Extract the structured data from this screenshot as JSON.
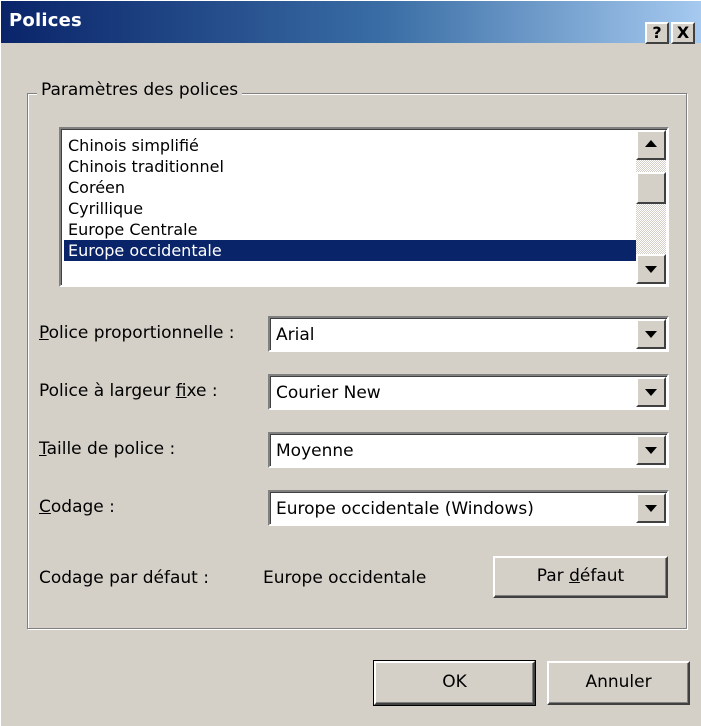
{
  "window": {
    "title": "Polices",
    "help_button": "?",
    "close_button": "X"
  },
  "group": {
    "legend": "Paramètres des polices"
  },
  "script_list": {
    "items": [
      "Chinois simplifié",
      "Chinois traditionnel",
      "Coréen",
      "Cyrillique",
      "Europe Centrale",
      "Europe occidentale"
    ],
    "selected": "Europe occidentale"
  },
  "proportional_font": {
    "label_accel": "P",
    "label_rest": "olice proportionnelle :",
    "value": "Arial"
  },
  "fixed_font": {
    "label_before": "Police à largeur ",
    "label_accel": "f",
    "label_after": "ixe :",
    "value": "Courier New"
  },
  "font_size": {
    "label_accel": "T",
    "label_rest": "aille de police :",
    "value": "Moyenne"
  },
  "encoding": {
    "label_accel": "C",
    "label_rest": "odage :",
    "value": "Europe occidentale (Windows)"
  },
  "default_encoding": {
    "label": "Codage par défaut :",
    "value": "Europe occidentale"
  },
  "buttons": {
    "default_before": "Par ",
    "default_accel": "d",
    "default_after": "éfaut",
    "ok": "OK",
    "cancel": "Annuler"
  },
  "colors": {
    "face": "#d4d0c8",
    "title_start": "#0a246a",
    "title_end": "#a6caf0",
    "selection": "#0a246a"
  }
}
